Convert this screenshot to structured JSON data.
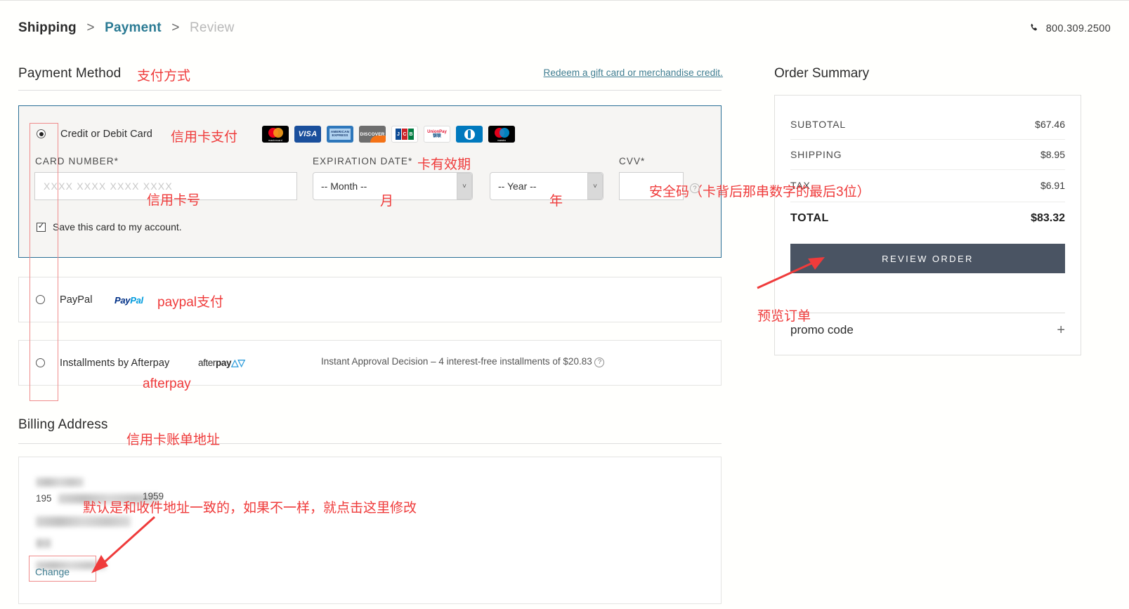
{
  "header": {
    "breadcrumb": {
      "shipping": "Shipping",
      "sep1": ">",
      "payment": "Payment",
      "sep2": ">",
      "review": "Review"
    },
    "phone": "800.309.2500",
    "phone_icon": "phone-icon"
  },
  "payment_section": {
    "title": "Payment Method",
    "gift_link": "Redeem a gift card or merchandise credit."
  },
  "credit_card": {
    "option_label": "Credit or Debit Card",
    "selected": true,
    "brands": [
      {
        "name": "mastercard",
        "label": "mastercard"
      },
      {
        "name": "visa",
        "label": "VISA"
      },
      {
        "name": "amex",
        "label": "AMERICAN EXPRESS"
      },
      {
        "name": "discover",
        "label": "DISCOVER"
      },
      {
        "name": "jcb",
        "label": "JCB"
      },
      {
        "name": "unionpay",
        "label": "UnionPay"
      },
      {
        "name": "diners-club",
        "label": "Diners Club"
      },
      {
        "name": "maestro",
        "label": "maestro"
      }
    ],
    "card_number_label": "CARD NUMBER*",
    "card_number_value": "",
    "card_number_placeholder": "XXXX XXXX XXXX XXXX",
    "expiration_label": "EXPIRATION DATE*",
    "month_value": "-- Month --",
    "year_value": "-- Year --",
    "cvv_label": "CVV*",
    "cvv_value": "",
    "save_card_label": "Save this card to my account.",
    "save_card_checked": true,
    "checkmark": "✓"
  },
  "paypal": {
    "option_label": "PayPal",
    "logo_a": "Pay",
    "logo_b": "Pal",
    "selected": false
  },
  "afterpay": {
    "option_label": "Installments by Afterpay",
    "logo_thin": "after",
    "logo_bold": "pay",
    "logo_mark": "△▽",
    "note": "Instant Approval Decision – 4 interest-free installments of $20.83",
    "help_icon": "?",
    "selected": false
  },
  "billing": {
    "title": "Billing Address",
    "redacted_year": "195",
    "redacted_year2": "1959",
    "change_label": "Change"
  },
  "order_summary": {
    "title": "Order Summary",
    "rows": [
      {
        "label": "SUBTOTAL",
        "value": "$67.46"
      },
      {
        "label": "SHIPPING",
        "value": "$8.95"
      },
      {
        "label": "TAX",
        "value": "$6.91"
      }
    ],
    "total_label": "TOTAL",
    "total_value": "$83.32",
    "review_button": "REVIEW ORDER",
    "promo_label": "promo code",
    "promo_plus": "+"
  },
  "annotations": {
    "payment_method": "支付方式",
    "credit_card": "信用卡支付",
    "card_number": "信用卡号",
    "expiration": "卡有效期",
    "month": "月",
    "year": "年",
    "cvv": "安全码（卡背后那串数字的最后3位）",
    "paypal": "paypal支付",
    "afterpay": "afterpay",
    "billing_address": "信用卡账单地址",
    "billing_note": "默认是和收件地址一致的，如果不一样，就点击这里修改",
    "review_order": "预览订单"
  },
  "colors": {
    "accent_teal": "#2a7a93",
    "annotation_red": "#ef3b3b",
    "button_slate": "#4a5463",
    "panel_border_blue": "#2a6f96"
  }
}
